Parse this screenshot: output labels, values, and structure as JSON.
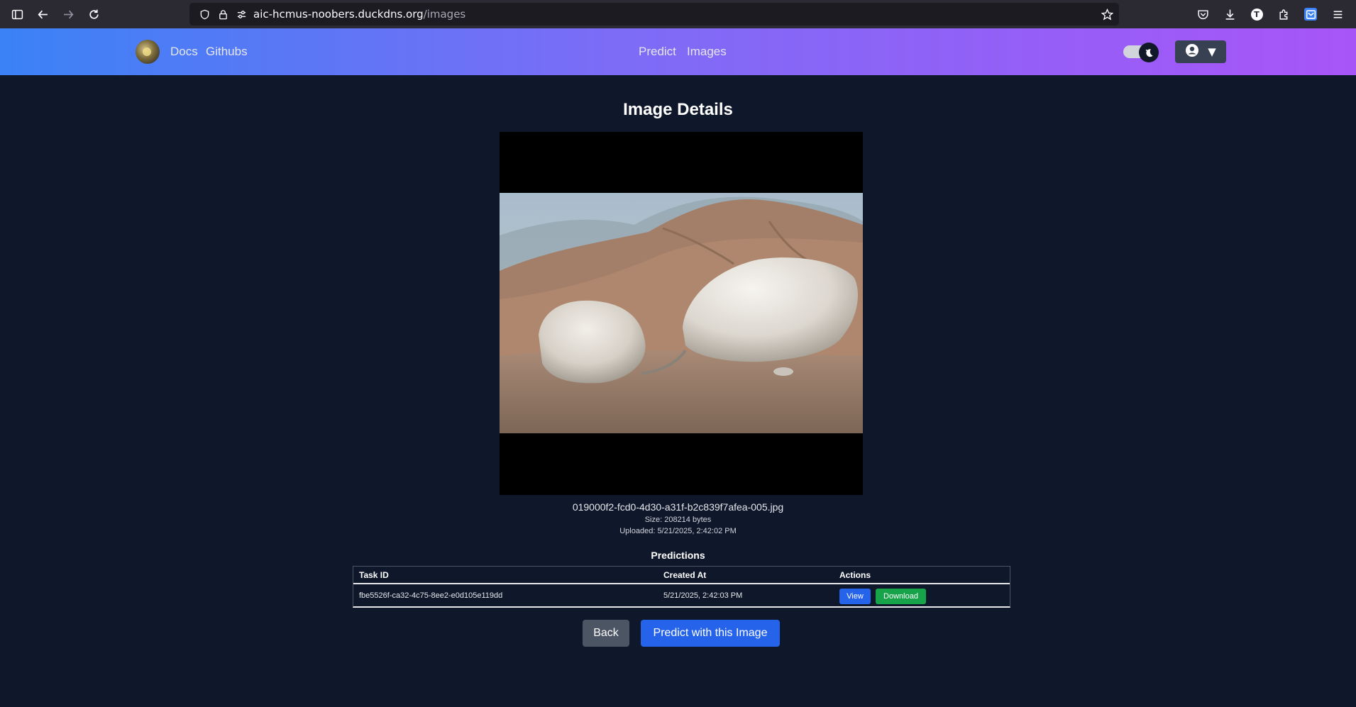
{
  "browser": {
    "url_host": "aic-hcmus-noobers.duckdns.org",
    "url_path": "/images",
    "profile_initial": "T",
    "icons": [
      "sidebar-icon",
      "back-icon",
      "forward-icon",
      "reload-icon",
      "shield-icon",
      "lock-icon",
      "permissions-icon",
      "bookmark-star-icon",
      "pocket-icon",
      "downloads-icon",
      "extensions-icon",
      "menu-icon"
    ]
  },
  "navbar": {
    "docs_label": "Docs",
    "githubs_label": "Githubs",
    "predict_label": "Predict",
    "images_label": "Images",
    "theme_toggle_icon": "moon-icon",
    "user_icon": "user-circle-icon",
    "user_caret": "▼"
  },
  "content": {
    "title": "Image Details",
    "filename": "019000f2-fcd0-4d30-a31f-b2c839f7afea-005.jpg",
    "size_text": "Size: 208214 bytes",
    "uploaded_text": "Uploaded: 5/21/2025, 2:42:02 PM",
    "predictions_title": "Predictions",
    "table": {
      "headers": [
        "Task ID",
        "Created At",
        "Actions"
      ],
      "rows": [
        {
          "task_id": "fbe5526f-ca32-4c75-8ee2-e0d105e119dd",
          "created_at": "5/21/2025, 2:42:03 PM",
          "view_label": "View",
          "download_label": "Download"
        }
      ]
    },
    "back_label": "Back",
    "predict_button_label": "Predict with this Image"
  },
  "colors": {
    "page_bg": "#0f172a",
    "nav_gradient_start": "#3b82f6",
    "nav_gradient_end": "#a855f7",
    "primary": "#2563eb",
    "success": "#16a34a",
    "secondary": "#4b5563"
  }
}
